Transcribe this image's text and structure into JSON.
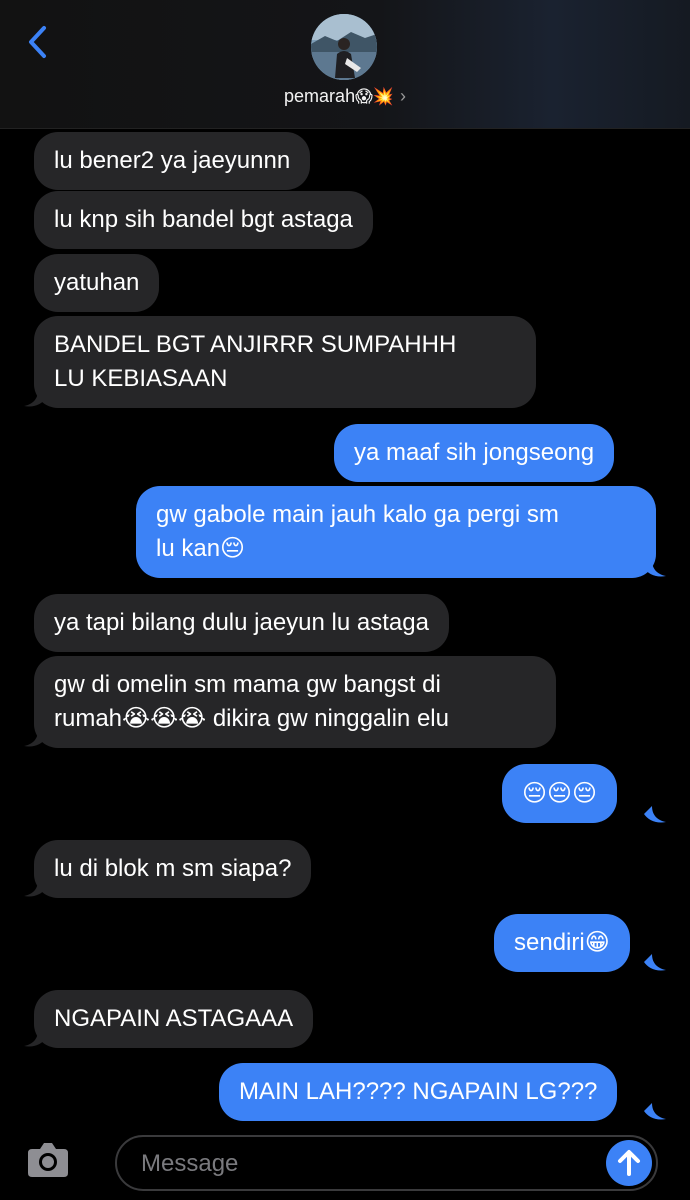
{
  "header": {
    "contact_name": "pemarah",
    "contact_emoji": "😱💥",
    "chevron": "›",
    "back_icon": "chevron-left-icon",
    "avatar": "contact-avatar-photo"
  },
  "messages": [
    {
      "side": "in",
      "text": "lu bener2 ya jaeyunnn"
    },
    {
      "side": "in",
      "text": "lu knp sih bandel bgt astaga"
    },
    {
      "side": "in",
      "text": "yatuhan"
    },
    {
      "side": "in",
      "text": "BANDEL BGT ANJIRRR SUMPAHHH\nLU KEBIASAAN"
    },
    {
      "side": "out",
      "text": "ya maaf sih jongseong"
    },
    {
      "side": "out",
      "text": "gw gabole main jauh kalo ga pergi sm\nlu kan😔"
    },
    {
      "side": "in",
      "text": "ya tapi bilang dulu jaeyun lu astaga"
    },
    {
      "side": "in",
      "text": "gw di omelin sm mama gw bangst di\nrumah😭😭😭 dikira gw ninggalin elu"
    },
    {
      "side": "out",
      "text": "😔😔😔"
    },
    {
      "side": "in",
      "text": "lu di blok m sm siapa?"
    },
    {
      "side": "out",
      "text": "sendiri😁"
    },
    {
      "side": "in",
      "text": "NGAPAIN ASTAGAAA"
    },
    {
      "side": "out",
      "text": "MAIN LAH???? NGAPAIN LG???"
    }
  ],
  "composer": {
    "placeholder": "Message",
    "camera_icon": "camera-icon",
    "send_icon": "arrow-up-icon"
  },
  "colors": {
    "incoming_bubble": "#262628",
    "outgoing_bubble": "#3c82f6",
    "accent": "#3c82f6",
    "background": "#000000"
  }
}
